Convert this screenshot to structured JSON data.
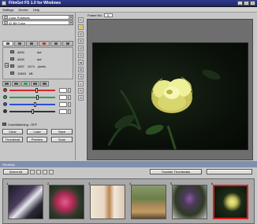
{
  "window": {
    "title": "FilmGet FS 1.0 for Windows"
  },
  "menu": [
    "Settings",
    "Device",
    "Help"
  ],
  "colors": {
    "titlebar": "#23307a",
    "selected_thumb_border": "#d62020",
    "slider_red": "#d12a2a",
    "slider_green": "#2f9d4f",
    "slider_blue": "#2a4fd1"
  },
  "profile": {
    "value": "Color Positives"
  },
  "mode": {
    "value": "42-Bit Color"
  },
  "info": {
    "width": "4000",
    "width_unit": "dot",
    "height": "4000",
    "height_unit": "dot",
    "resolution": "1837",
    "resolution_2": "1074",
    "resolution_unit": "pixels",
    "size": "11563",
    "size_unit": "kB"
  },
  "sliders": [
    {
      "name": "red",
      "color": "#d12a2a",
      "level": 0.58
    },
    {
      "name": "green",
      "color": "#2f9d4f",
      "level": 0.6
    },
    {
      "name": "blue",
      "color": "#2a4fd1",
      "level": 0.55
    },
    {
      "name": "gray",
      "color": "#333333",
      "level": 0.5
    }
  ],
  "colormatching": {
    "label": "ColorMatching : OFF"
  },
  "buttons": {
    "clear": "Clear",
    "load": "Load",
    "save": "Save",
    "thumbnail": "Thumbnail",
    "preview": "Preview",
    "scan": "Scan"
  },
  "frame": {
    "label": "Frame No.",
    "value": "6"
  },
  "filmstrip": {
    "title": "FilmStrip",
    "select_all": "Select All",
    "transfer": "Transfer Thumbnails",
    "thumbnails": [
      {
        "num": "1",
        "selected": false
      },
      {
        "num": "2",
        "selected": false
      },
      {
        "num": "3",
        "selected": false
      },
      {
        "num": "4",
        "selected": false
      },
      {
        "num": "5",
        "selected": false
      },
      {
        "num": "6",
        "selected": true
      }
    ]
  }
}
